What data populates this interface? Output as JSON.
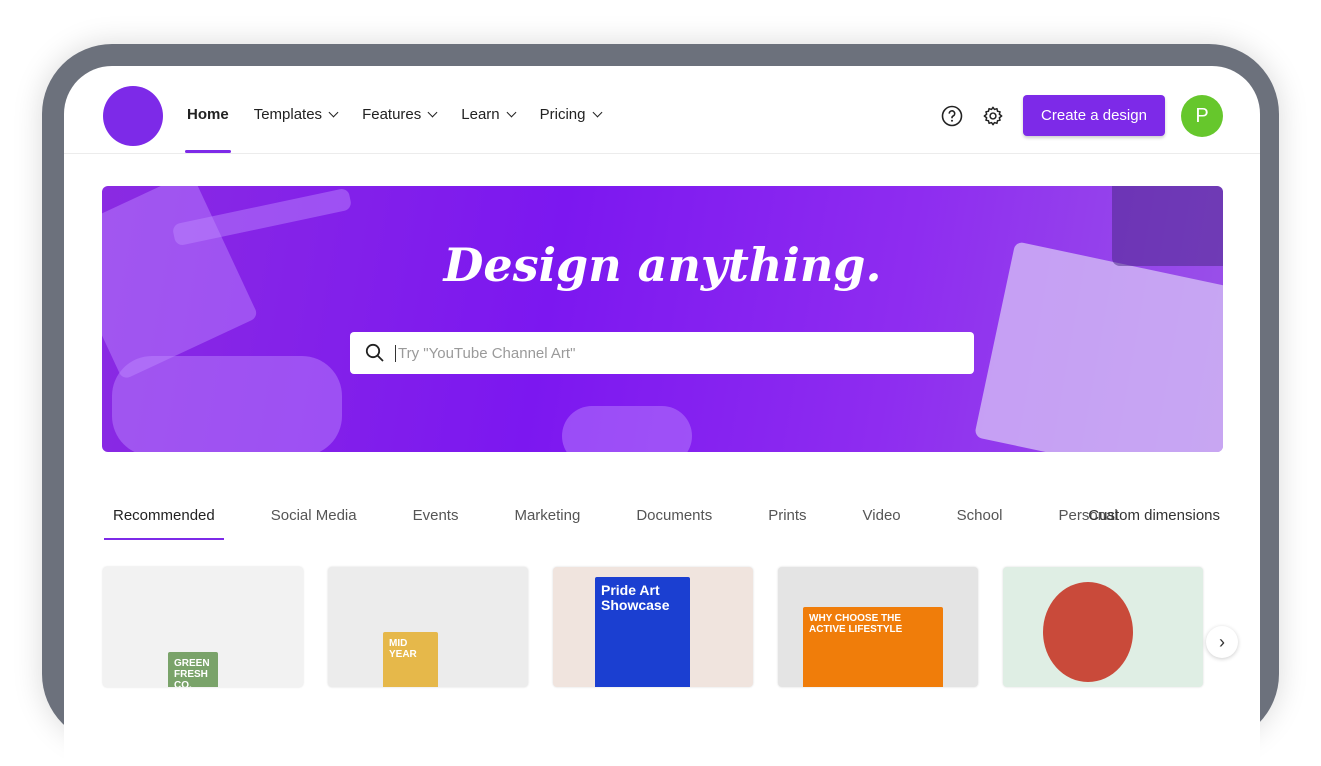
{
  "nav": {
    "items": [
      {
        "label": "Home",
        "active": true
      },
      {
        "label": "Templates"
      },
      {
        "label": "Features"
      },
      {
        "label": "Learn"
      },
      {
        "label": "Pricing"
      }
    ],
    "create_label": "Create a design",
    "avatar_initial": "P"
  },
  "banner": {
    "title": "Design anything.",
    "search_placeholder": "Try \"YouTube Channel Art\""
  },
  "tabs": [
    "Recommended",
    "Social Media",
    "Events",
    "Marketing",
    "Documents",
    "Prints",
    "Video",
    "School",
    "Personal"
  ],
  "custom_dimensions": "Custom dimensions",
  "cards": [
    {
      "bg": "#f2f2f2",
      "accent": "#7aa36a",
      "text": "GREEN FRESH CO."
    },
    {
      "bg": "#ececec",
      "accent": "#e6b84a",
      "text": "MID YEAR"
    },
    {
      "bg": "#f0e4de",
      "accent": "#1b3fd1",
      "text": "Pride Art Showcase"
    },
    {
      "bg": "#e4e4e4",
      "accent": "#f07d0a",
      "text": "WHY CHOOSE THE ACTIVE LIFESTYLE"
    },
    {
      "bg": "#dfeee4",
      "accent": "#c94a3a",
      "text": ""
    }
  ],
  "colors": {
    "accent": "#7d2ae8",
    "avatar": "#66c72c"
  }
}
